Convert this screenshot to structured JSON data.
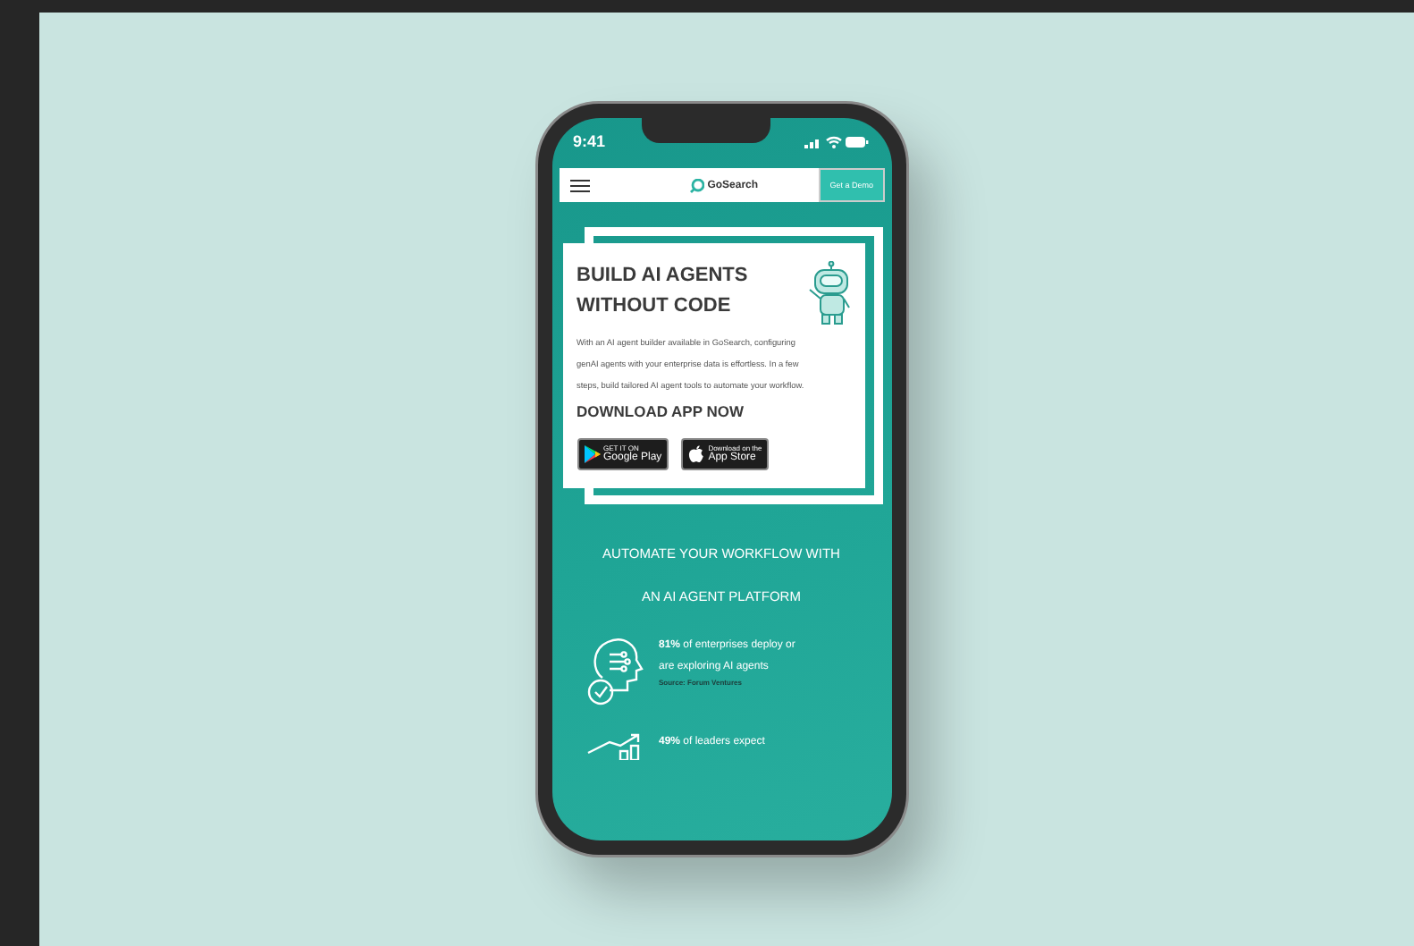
{
  "status_bar": {
    "time": "9:41"
  },
  "nav": {
    "brand": "GoSearch",
    "cta": "Get a Demo"
  },
  "hero": {
    "title": "BUILD AI AGENTS WITHOUT CODE",
    "body": "With an AI agent builder available in GoSearch, configuring genAI agents with your enterprise data is effortless. In a few steps, build tailored AI agent tools to automate your workflow.",
    "download_heading": "DOWNLOAD APP NOW",
    "stores": [
      {
        "kind": "google",
        "small": "GET IT ON",
        "big": "Google Play"
      },
      {
        "kind": "apple",
        "small": "Download on the",
        "big": "App Store"
      }
    ]
  },
  "section": {
    "heading": "AUTOMATE YOUR WORKFLOW WITH AN AI AGENT PLATFORM",
    "stats": [
      {
        "kind": "head",
        "text": "**81%** of enterprises deploy or are exploring AI agents",
        "source": "Source: Forum Ventures"
      },
      {
        "kind": "chart",
        "text": "**49%** of leaders expect"
      }
    ]
  }
}
